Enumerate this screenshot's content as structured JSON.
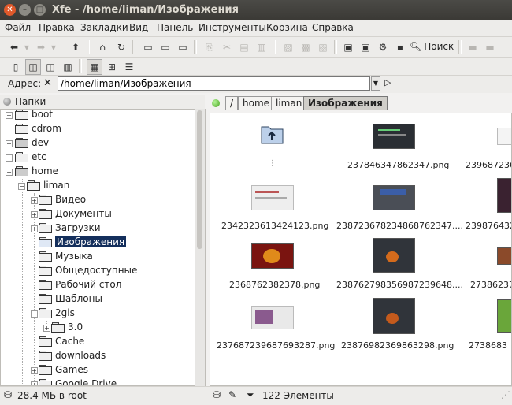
{
  "window": {
    "title": "Xfe - /home/liman/Изображения"
  },
  "menu": [
    "Файл",
    "Правка",
    "Закладки",
    "Вид",
    "Панель",
    "Инструменты",
    "Корзина",
    "Справка"
  ],
  "toolbar": {
    "search_label": "Поиск"
  },
  "address": {
    "label": "Адрес:",
    "value": "/home/liman/Изображения"
  },
  "tree": {
    "title": "Папки",
    "items": [
      {
        "label": "boot"
      },
      {
        "label": "cdrom"
      },
      {
        "label": "dev"
      },
      {
        "label": "etc"
      },
      {
        "label": "home"
      },
      {
        "label": "liman"
      },
      {
        "label": "Видео"
      },
      {
        "label": "Документы"
      },
      {
        "label": "Загрузки"
      },
      {
        "label": "Изображения"
      },
      {
        "label": "Музыка"
      },
      {
        "label": "Общедоступные"
      },
      {
        "label": "Рабочий стол"
      },
      {
        "label": "Шаблоны"
      },
      {
        "label": "2gis"
      },
      {
        "label": "3.0"
      },
      {
        "label": "Cache"
      },
      {
        "label": "downloads"
      },
      {
        "label": "Games"
      },
      {
        "label": "Google Drive"
      }
    ]
  },
  "breadcrumbs": [
    "/",
    "home",
    "liman",
    "Изображения"
  ],
  "files": [
    {
      "name": ""
    },
    {
      "name": "237846347862347.png"
    },
    {
      "name": "2396872364"
    },
    {
      "name": "2342323613424123.png"
    },
    {
      "name": "23872367823486876234​7...."
    },
    {
      "name": "239876432"
    },
    {
      "name": "2368762382378.png"
    },
    {
      "name": "23876279835698723964​8...."
    },
    {
      "name": "27386237"
    },
    {
      "name": "237687239687693287.png"
    },
    {
      "name": "23876982369863298.png"
    },
    {
      "name": "2738683"
    }
  ],
  "status": {
    "left": "28.4 МБ в root",
    "count": "122 Элементы"
  }
}
